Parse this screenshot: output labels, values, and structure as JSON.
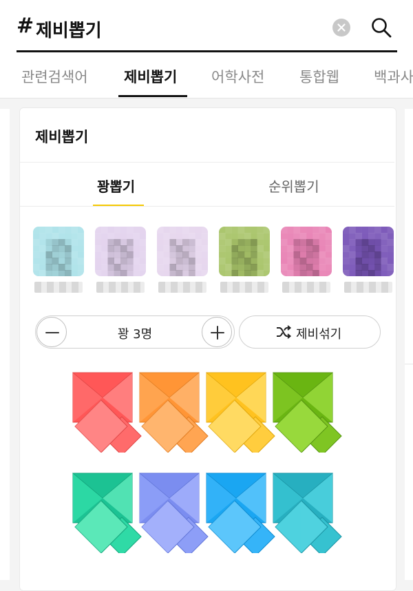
{
  "search": {
    "hash": "#",
    "query": "제비뽑기"
  },
  "tabs": [
    "관련검색어",
    "제비뽑기",
    "어학사전",
    "통합웹",
    "백과사"
  ],
  "card": {
    "title": "제비뽑기",
    "modes": [
      "꽝뽑기",
      "순위뽑기"
    ],
    "counter_label": "꽝 3명",
    "shuffle_label": "제비섞기"
  },
  "avatars": [
    {
      "icon": "avatar-icon",
      "color": "#aee3ea"
    },
    {
      "icon": "avatar-icon",
      "color": "#e3d3ee"
    },
    {
      "icon": "avatar-icon",
      "color": "#e6d6ee"
    },
    {
      "icon": "avatar-icon",
      "color": "#a9c56a"
    },
    {
      "icon": "avatar-icon",
      "color": "#e983b5"
    },
    {
      "icon": "avatar-icon",
      "color": "#7a56b8"
    }
  ],
  "envelopes": [
    {
      "back": "#ff5757",
      "front": "#ff8585",
      "flap": "#ff6b6b",
      "stroke": "#e04646"
    },
    {
      "back": "#ff9536",
      "front": "#ffb56e",
      "flap": "#ffa552",
      "stroke": "#e07c22"
    },
    {
      "back": "#ffc21f",
      "front": "#ffda62",
      "flap": "#ffcd3e",
      "stroke": "#e0a60c"
    },
    {
      "back": "#6ab512",
      "front": "#98d93c",
      "flap": "#7fc523",
      "stroke": "#559410"
    },
    {
      "back": "#1cc293",
      "front": "#5be8b8",
      "flap": "#2fdaa6",
      "stroke": "#14a47b"
    },
    {
      "back": "#7b8df0",
      "front": "#a3b0fb",
      "flap": "#8d9ef7",
      "stroke": "#6276d8"
    },
    {
      "back": "#1aa6f2",
      "front": "#5cc6fb",
      "flap": "#35b4f8",
      "stroke": "#0e8bd0"
    },
    {
      "back": "#27afc0",
      "front": "#4fd2df",
      "flap": "#36c2d0",
      "stroke": "#1a93a3"
    }
  ]
}
